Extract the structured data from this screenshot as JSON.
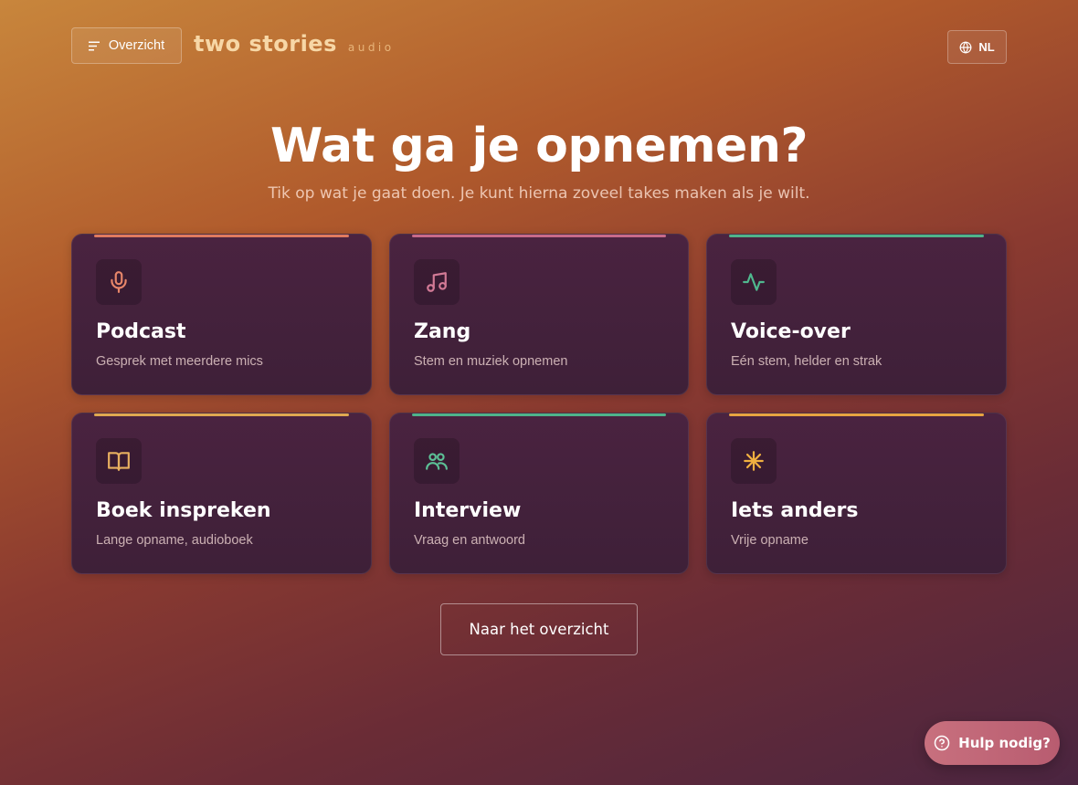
{
  "header": {
    "menu_label": "Overzicht",
    "logo_main": "two stories",
    "logo_sub": "audio",
    "language": "NL"
  },
  "main": {
    "title": "Wat ga je opnemen?",
    "subtitle": "Tik op wat je gaat doen. Je kunt hierna zoveel takes maken als je wilt.",
    "cards": [
      {
        "title": "Podcast",
        "description": "Gesprek met meerdere mics",
        "icon": "microphone-icon",
        "accent": "#e07a5f"
      },
      {
        "title": "Zang",
        "description": "Stem en muziek opnemen",
        "icon": "music-note-icon",
        "accent": "#c86a8a"
      },
      {
        "title": "Voice-over",
        "description": "Eén stem, helder en strak",
        "icon": "waveform-icon",
        "accent": "#4fb38a"
      },
      {
        "title": "Boek inspreken",
        "description": "Lange opname, audioboek",
        "icon": "book-icon",
        "accent": "#e0a850"
      },
      {
        "title": "Interview",
        "description": "Vraag en antwoord",
        "icon": "users-icon",
        "accent": "#4fb38a"
      },
      {
        "title": "Iets anders",
        "description": "Vrije opname",
        "icon": "asterisk-icon",
        "accent": "#e8a440"
      }
    ],
    "overview_button": "Naar het overzicht"
  },
  "help": {
    "label": "Hulp nodig?"
  }
}
